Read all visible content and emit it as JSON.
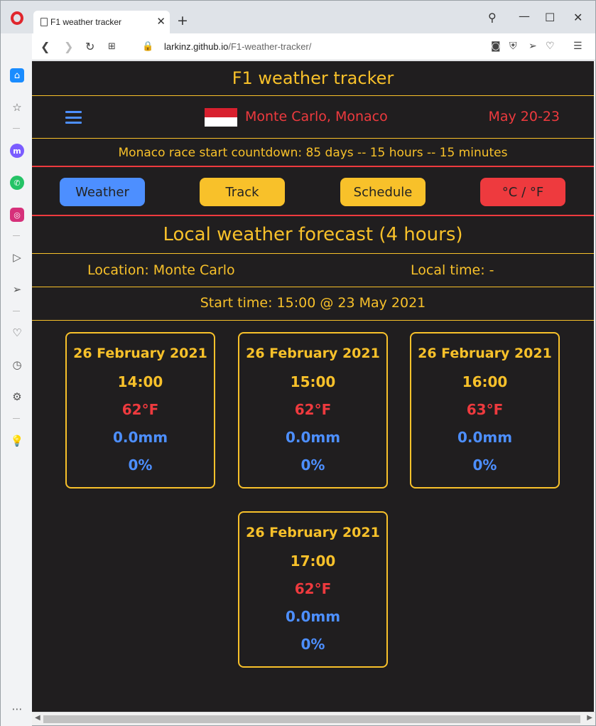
{
  "browser": {
    "tab_title": "F1 weather tracker",
    "new_tab_glyph": "+",
    "url_host": "larkinz.github.io",
    "url_path": "/F1-weather-tracker/",
    "icons": {
      "logo": "opera-logo",
      "tab_doc": "document-icon",
      "search": "search-icon",
      "minimize": "minimize-icon",
      "maximize": "maximize-icon",
      "close": "close-icon",
      "back": "back-icon",
      "forward": "forward-icon",
      "reload": "reload-icon",
      "speed_dial": "grid-icon",
      "lock": "lock-icon",
      "snapshot": "camera-icon",
      "adblock": "shield-icon",
      "send": "send-icon",
      "bookmark": "heart-icon",
      "easy_setup": "settings-sliders-icon"
    }
  },
  "sidebar": {
    "items": [
      {
        "name": "home",
        "icon": "home-icon"
      },
      {
        "name": "bookmarks",
        "icon": "star-icon"
      },
      {
        "name": "messenger",
        "icon": "messenger-icon"
      },
      {
        "name": "whatsapp",
        "icon": "whatsapp-icon"
      },
      {
        "name": "instagram",
        "icon": "instagram-icon"
      },
      {
        "name": "player",
        "icon": "play-icon"
      },
      {
        "name": "flow",
        "icon": "send-icon"
      },
      {
        "name": "favorites",
        "icon": "heart-icon"
      },
      {
        "name": "history",
        "icon": "clock-icon"
      },
      {
        "name": "settings",
        "icon": "gear-icon"
      },
      {
        "name": "tips",
        "icon": "lightbulb-icon"
      },
      {
        "name": "more",
        "icon": "more-icon"
      }
    ]
  },
  "page": {
    "title": "F1 weather tracker",
    "menu_icon": "hamburger-icon",
    "flag": "monaco-flag",
    "race_location": "Monte Carlo, Monaco",
    "race_dates": "May 20-23",
    "countdown": "Monaco race start countdown: 85 days -- 15 hours -- 15 minutes",
    "buttons": {
      "weather": "Weather",
      "track": "Track",
      "schedule": "Schedule",
      "units": "°C / °F"
    },
    "section_title": "Local weather forecast (4 hours)",
    "location": "Location: Monte Carlo",
    "local_time": "Local time: -",
    "start_time": "Start time: 15:00 @ 23 May 2021",
    "forecast": [
      {
        "date": "26 February 2021",
        "time": "14:00",
        "temp": "62°F",
        "rain": "0.0mm",
        "prob": "0%"
      },
      {
        "date": "26 February 2021",
        "time": "15:00",
        "temp": "62°F",
        "rain": "0.0mm",
        "prob": "0%"
      },
      {
        "date": "26 February 2021",
        "time": "16:00",
        "temp": "63°F",
        "rain": "0.0mm",
        "prob": "0%"
      },
      {
        "date": "26 February 2021",
        "time": "17:00",
        "temp": "62°F",
        "rain": "0.0mm",
        "prob": "0%"
      }
    ]
  },
  "colors": {
    "background": "#201e1f",
    "yellow": "#f8c12a",
    "red": "#ee3a3e",
    "blue": "#4d8fff"
  }
}
